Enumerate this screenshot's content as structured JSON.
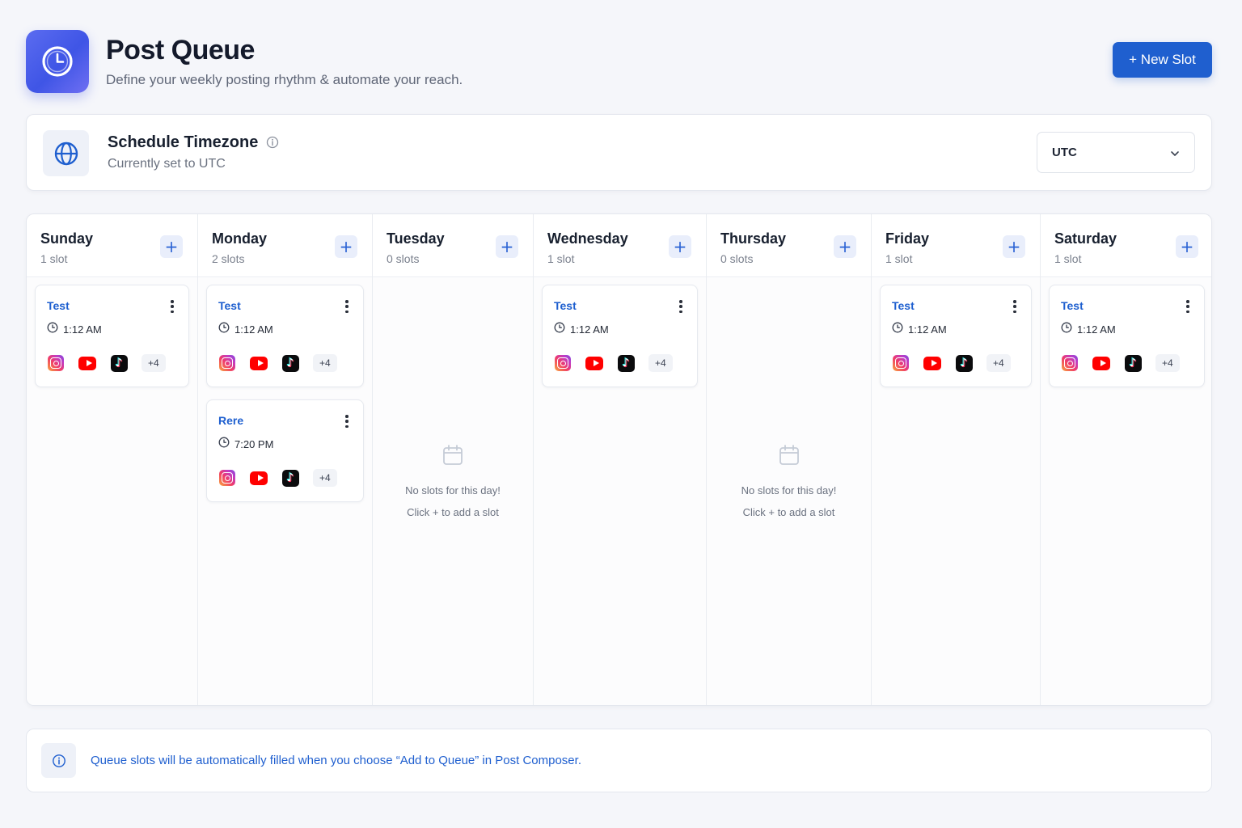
{
  "header": {
    "title": "Post Queue",
    "subtitle": "Define your weekly posting rhythm & automate your reach.",
    "app_icon": "clock-icon",
    "new_slot_label": "+ New Slot"
  },
  "timezone": {
    "title": "Schedule Timezone",
    "subtitle": "Currently set to UTC",
    "selected": "UTC",
    "icon": "globe-icon"
  },
  "days": [
    {
      "name": "Sunday",
      "count_label": "1 slot",
      "slots": [
        {
          "name": "Test",
          "time": "1:12 AM",
          "more": "+4"
        }
      ]
    },
    {
      "name": "Monday",
      "count_label": "2 slots",
      "slots": [
        {
          "name": "Test",
          "time": "1:12 AM",
          "more": "+4"
        },
        {
          "name": "Rere",
          "time": "7:20 PM",
          "more": "+4"
        }
      ]
    },
    {
      "name": "Tuesday",
      "count_label": "0 slots",
      "slots": [],
      "empty_line1": "No slots for this day!",
      "empty_line2": "Click + to add a slot"
    },
    {
      "name": "Wednesday",
      "count_label": "1 slot",
      "slots": [
        {
          "name": "Test",
          "time": "1:12 AM",
          "more": "+4"
        }
      ]
    },
    {
      "name": "Thursday",
      "count_label": "0 slots",
      "slots": [],
      "empty_line1": "No slots for this day!",
      "empty_line2": "Click + to add a slot"
    },
    {
      "name": "Friday",
      "count_label": "1 slot",
      "slots": [
        {
          "name": "Test",
          "time": "1:12 AM",
          "more": "+4"
        }
      ]
    },
    {
      "name": "Saturday",
      "count_label": "1 slot",
      "slots": [
        {
          "name": "Test",
          "time": "1:12 AM",
          "more": "+4"
        }
      ]
    }
  ],
  "platform_icons": [
    "instagram-icon",
    "youtube-icon",
    "tiktok-icon"
  ],
  "add_symbol": "+",
  "info": {
    "text": "Queue slots will be automatically filled when you choose “Add to Queue” in Post Composer."
  },
  "colors": {
    "accent": "#1f5fcf",
    "app_icon_gradient_start": "#5b6cf0",
    "app_icon_gradient_end": "#3f55e6",
    "slot_name": "#1e5fcf"
  }
}
